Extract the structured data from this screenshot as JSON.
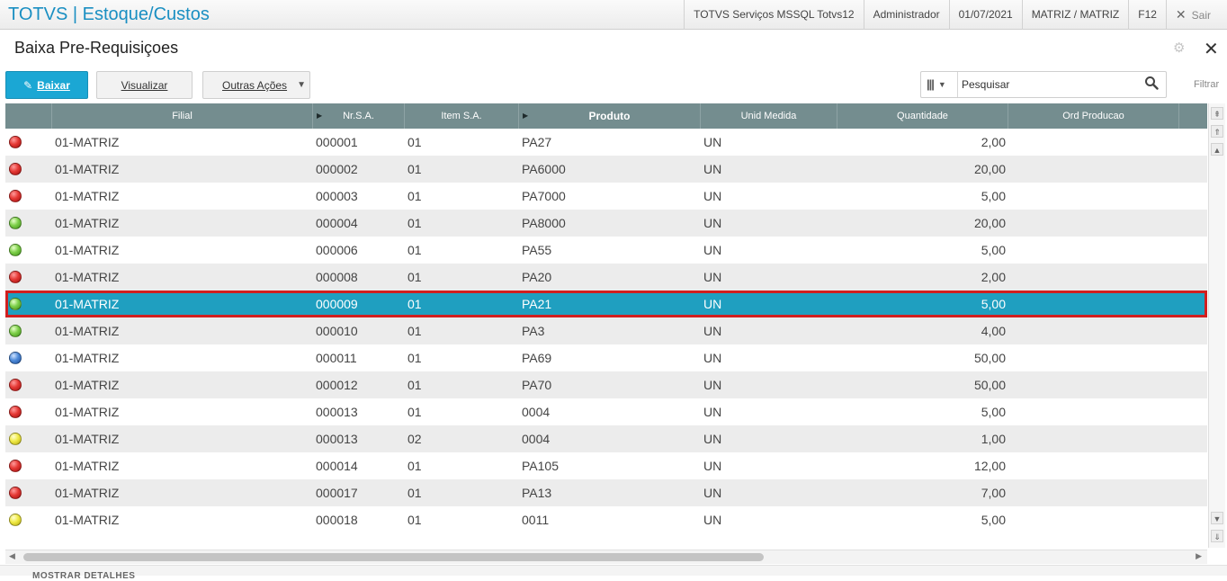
{
  "topbar": {
    "app": "TOTVS",
    "sep": "|",
    "module": "Estoque/Custos",
    "server": "TOTVS Serviços MSSQL Totvs12",
    "user": "Administrador",
    "date": "01/07/2021",
    "branch": "MATRIZ / MATRIZ",
    "shortcut": "F12",
    "exit_label": "Sair"
  },
  "page": {
    "title": "Baixa Pre-Requisiçoes"
  },
  "toolbar": {
    "baixar_label": "Baixar",
    "visualizar_label": "Visualizar",
    "outras_label": "Outras Ações",
    "search_placeholder": "Pesquisar",
    "filtrar_label": "Filtrar"
  },
  "grid": {
    "headers": {
      "filial": "Filial",
      "nrsa": "Nr.S.A.",
      "itemsa": "Item S.A.",
      "produto": "Produto",
      "unid": "Unid Medida",
      "qtd": "Quantidade",
      "ordprod": "Ord Producao"
    },
    "rows": [
      {
        "status": "red",
        "filial": "01-MATRIZ",
        "nrsa": "000001",
        "item": "01",
        "produto": "PA27",
        "unid": "UN",
        "qtd": "2,00"
      },
      {
        "status": "red",
        "filial": "01-MATRIZ",
        "nrsa": "000002",
        "item": "01",
        "produto": "PA6000",
        "unid": "UN",
        "qtd": "20,00"
      },
      {
        "status": "red",
        "filial": "01-MATRIZ",
        "nrsa": "000003",
        "item": "01",
        "produto": "PA7000",
        "unid": "UN",
        "qtd": "5,00"
      },
      {
        "status": "green",
        "filial": "01-MATRIZ",
        "nrsa": "000004",
        "item": "01",
        "produto": "PA8000",
        "unid": "UN",
        "qtd": "20,00"
      },
      {
        "status": "green",
        "filial": "01-MATRIZ",
        "nrsa": "000006",
        "item": "01",
        "produto": "PA55",
        "unid": "UN",
        "qtd": "5,00"
      },
      {
        "status": "red",
        "filial": "01-MATRIZ",
        "nrsa": "000008",
        "item": "01",
        "produto": "PA20",
        "unid": "UN",
        "qtd": "2,00"
      },
      {
        "status": "green",
        "filial": "01-MATRIZ",
        "nrsa": "000009",
        "item": "01",
        "produto": "PA21",
        "unid": "UN",
        "qtd": "5,00",
        "selected": true
      },
      {
        "status": "green",
        "filial": "01-MATRIZ",
        "nrsa": "000010",
        "item": "01",
        "produto": "PA3",
        "unid": "UN",
        "qtd": "4,00"
      },
      {
        "status": "blue",
        "filial": "01-MATRIZ",
        "nrsa": "000011",
        "item": "01",
        "produto": "PA69",
        "unid": "UN",
        "qtd": "50,00"
      },
      {
        "status": "red",
        "filial": "01-MATRIZ",
        "nrsa": "000012",
        "item": "01",
        "produto": "PA70",
        "unid": "UN",
        "qtd": "50,00"
      },
      {
        "status": "red",
        "filial": "01-MATRIZ",
        "nrsa": "000013",
        "item": "01",
        "produto": "0004",
        "unid": "UN",
        "qtd": "5,00"
      },
      {
        "status": "yellow",
        "filial": "01-MATRIZ",
        "nrsa": "000013",
        "item": "02",
        "produto": "0004",
        "unid": "UN",
        "qtd": "1,00"
      },
      {
        "status": "red",
        "filial": "01-MATRIZ",
        "nrsa": "000014",
        "item": "01",
        "produto": "PA105",
        "unid": "UN",
        "qtd": "12,00"
      },
      {
        "status": "red",
        "filial": "01-MATRIZ",
        "nrsa": "000017",
        "item": "01",
        "produto": "PA13",
        "unid": "UN",
        "qtd": "7,00"
      },
      {
        "status": "yellow",
        "filial": "01-MATRIZ",
        "nrsa": "000018",
        "item": "01",
        "produto": "0011",
        "unid": "UN",
        "qtd": "5,00"
      }
    ]
  },
  "footer": {
    "details_label": "MOSTRAR DETALHES"
  },
  "colors": {
    "brand": "#1a8fc2",
    "primary_button": "#1ba7d4",
    "header": "#748d8f",
    "selected_row": "#1f9fc0",
    "selection_outline": "#d11f1f"
  }
}
